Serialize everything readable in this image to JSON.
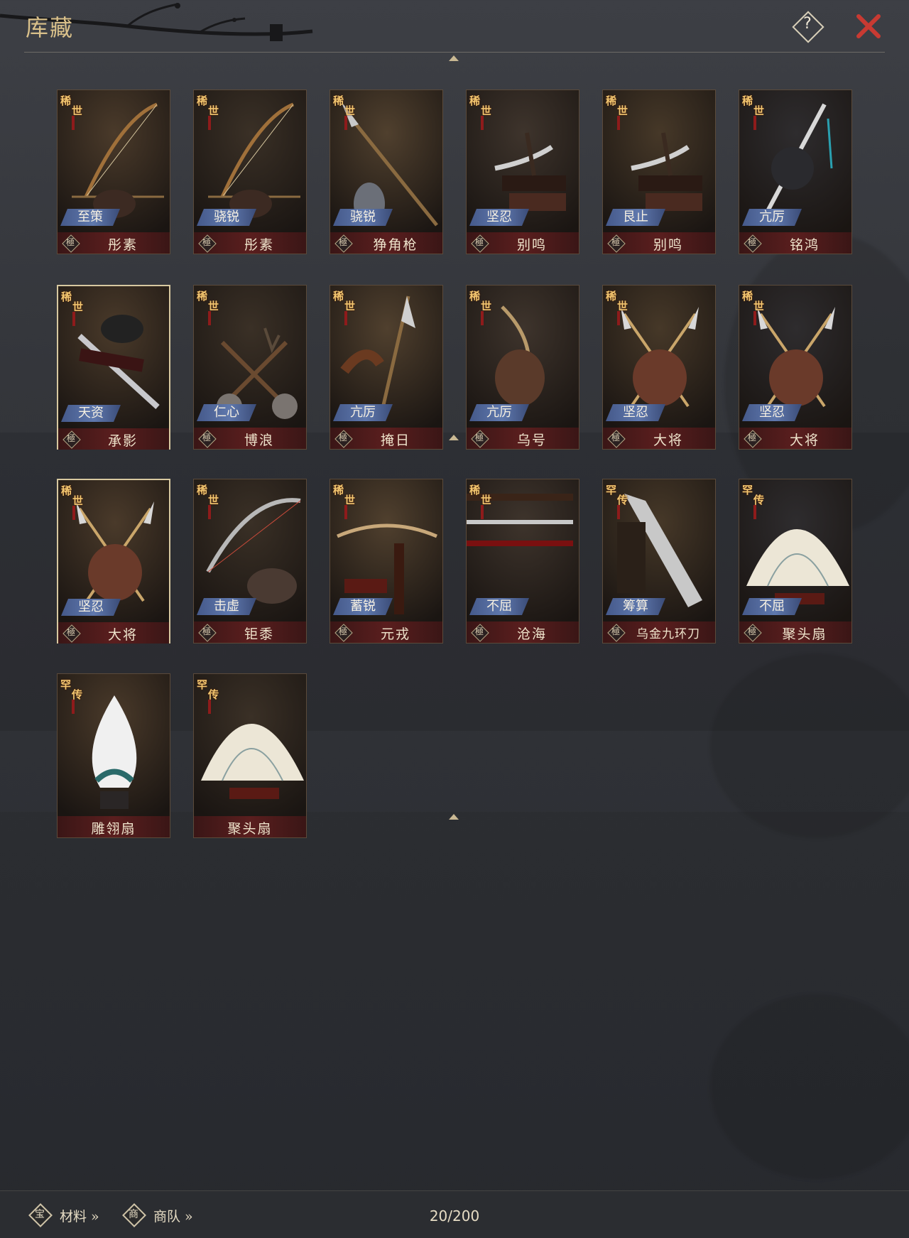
{
  "header": {
    "title": "库藏",
    "help_label": "?"
  },
  "colors": {
    "title": "#d9c08a",
    "close": "#c83a32",
    "tag_bg": "#5f78ad",
    "namebar_bg": "#5a1e1e"
  },
  "items": [
    {
      "name": "彤素",
      "tag": "至策",
      "tier": [
        "稀",
        "世"
      ],
      "grade": "極",
      "art": "bow"
    },
    {
      "name": "彤素",
      "tag": "骁锐",
      "tier": [
        "稀",
        "世"
      ],
      "grade": "極",
      "art": "bow"
    },
    {
      "name": "狰角枪",
      "tag": "骁锐",
      "tier": [
        "稀",
        "世"
      ],
      "grade": "極",
      "art": "spear"
    },
    {
      "name": "别鸣",
      "tag": "坚忍",
      "tier": [
        "稀",
        "世"
      ],
      "grade": "極",
      "art": "blade_stand"
    },
    {
      "name": "别鸣",
      "tag": "艮止",
      "tier": [
        "稀",
        "世"
      ],
      "grade": "極",
      "art": "blade_stand"
    },
    {
      "name": "铭鸿",
      "tag": "亢厉",
      "tier": [
        "稀",
        "世"
      ],
      "grade": "極",
      "art": "dragon_sword"
    },
    {
      "name": "承影",
      "tag": "天资",
      "tier": [
        "稀",
        "世"
      ],
      "grade": "極",
      "art": "sword",
      "selected": true
    },
    {
      "name": "博浪",
      "tag": "仁心",
      "tier": [
        "稀",
        "世"
      ],
      "grade": "極",
      "art": "hammers"
    },
    {
      "name": "掩日",
      "tag": "亢厉",
      "tier": [
        "稀",
        "世"
      ],
      "grade": "極",
      "art": "halberd"
    },
    {
      "name": "乌号",
      "tag": "亢厉",
      "tier": [
        "稀",
        "世"
      ],
      "grade": "極",
      "art": "bow2"
    },
    {
      "name": "大将",
      "tag": "坚忍",
      "tier": [
        "稀",
        "世"
      ],
      "grade": "極",
      "art": "crossed"
    },
    {
      "name": "大将",
      "tag": "坚忍",
      "tier": [
        "稀",
        "世"
      ],
      "grade": "極",
      "art": "crossed"
    },
    {
      "name": "大将",
      "tag": "坚忍",
      "tier": [
        "稀",
        "世"
      ],
      "grade": "極",
      "art": "crossed",
      "selected": true
    },
    {
      "name": "钜黍",
      "tag": "击虚",
      "tier": [
        "稀",
        "世"
      ],
      "grade": "極",
      "art": "bow3"
    },
    {
      "name": "元戎",
      "tag": "蓄锐",
      "tier": [
        "稀",
        "世"
      ],
      "grade": "極",
      "art": "crossbow"
    },
    {
      "name": "沧海",
      "tag": "不屈",
      "tier": [
        "稀",
        "世"
      ],
      "grade": "極",
      "art": "katana"
    },
    {
      "name": "乌金九环刀",
      "tag": "筹算",
      "tier": [
        "罕",
        "传"
      ],
      "grade": "極",
      "art": "broadsword"
    },
    {
      "name": "聚头扇",
      "tag": "不屈",
      "tier": [
        "罕",
        "传"
      ],
      "grade": "極",
      "art": "fan"
    },
    {
      "name": "雕翎扇",
      "tag": "",
      "tier": [
        "罕",
        "传"
      ],
      "grade": "",
      "art": "feather_fan"
    },
    {
      "name": "聚头扇",
      "tag": "",
      "tier": [
        "罕",
        "传"
      ],
      "grade": "",
      "art": "fan"
    }
  ],
  "footer": {
    "materials": {
      "icon_char": "宝",
      "label": "材料 »",
      "icon": "treasure-icon"
    },
    "caravan": {
      "icon_char": "商",
      "label": "商队 »",
      "icon": "caravan-icon"
    },
    "capacity": "20/200"
  }
}
